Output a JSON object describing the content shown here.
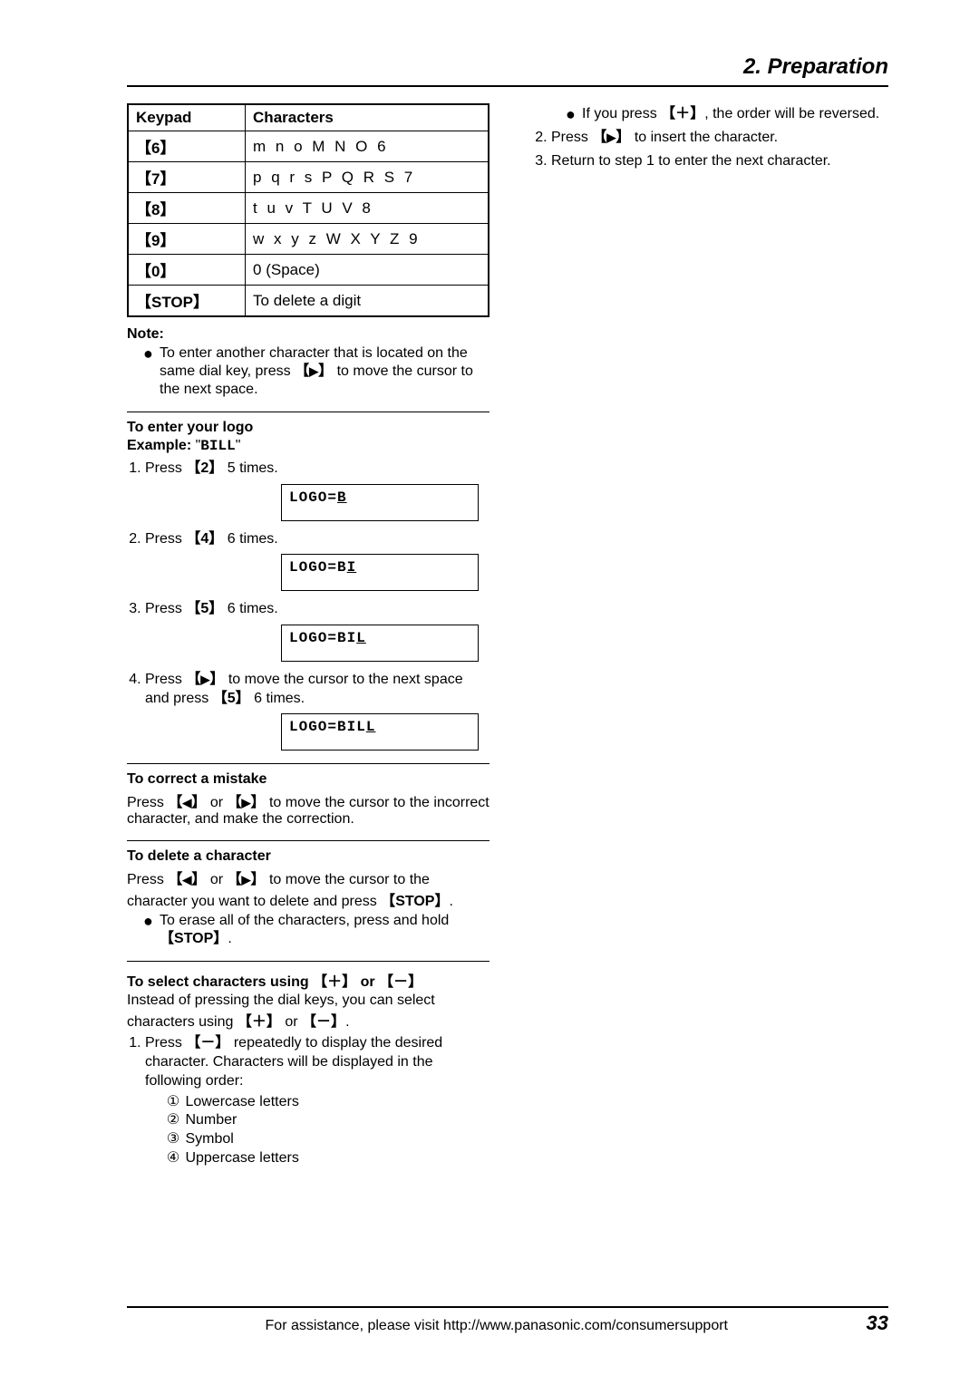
{
  "header": {
    "section_title": "2. Preparation"
  },
  "keypad_table": {
    "col_keypad": "Keypad",
    "col_chars": "Characters",
    "rows": [
      {
        "key": "【6】",
        "chars": "m  n  o  M  N  O  6"
      },
      {
        "key": "【7】",
        "chars": "p  q  r  s  P  Q  R  S  7"
      },
      {
        "key": "【8】",
        "chars": "t   u  v  T  U  V  8"
      },
      {
        "key": "【9】",
        "chars": "w  x  y  z  W  X  Y  Z  9"
      },
      {
        "key": "【0】",
        "chars": "0   (Space)"
      },
      {
        "key": "【STOP】",
        "chars": "To delete a digit"
      }
    ]
  },
  "note": {
    "label": "Note:",
    "text_pre": "To enter another character that is located on the same dial key, press ",
    "key": "▶",
    "text_post": " to move the cursor to the next space."
  },
  "logo_section": {
    "heading": "To enter your logo",
    "example_label": "Example: ",
    "example_quote_open": "\"",
    "example_value": "BILL",
    "example_quote_close": "\"",
    "steps": {
      "s1_pre": "Press ",
      "s1_key": "2",
      "s1_post": " 5 times.",
      "s1_lcd_prefix": "LOGO=",
      "s1_lcd_cursor": "B",
      "s2_pre": "Press ",
      "s2_key": "4",
      "s2_post": " 6 times.",
      "s2_lcd_prefix": "LOGO=B",
      "s2_lcd_cursor": "I",
      "s3_pre": "Press ",
      "s3_key": "5",
      "s3_post": " 6 times.",
      "s3_lcd_prefix": "LOGO=BI",
      "s3_lcd_cursor": "L",
      "s4_pre": "Press ",
      "s4_key1": "▶",
      "s4_mid": " to move the cursor to the next space and press ",
      "s4_key2": "5",
      "s4_post": " 6 times.",
      "s4_lcd_prefix": "LOGO=BIL",
      "s4_lcd_cursor": "L"
    }
  },
  "correct": {
    "heading": "To correct a mistake",
    "text_pre": "Press ",
    "key_left": "◀",
    "or": " or ",
    "key_right": "▶",
    "text_post": " to move the cursor to the incorrect character, and make the correction."
  },
  "delete": {
    "heading": "To delete a character",
    "text_pre": "Press ",
    "key_left": "◀",
    "or": " or ",
    "key_right": "▶",
    "text_mid": " to move the cursor to the character you want to delete and press ",
    "key_stop": "STOP",
    "text_post": ".",
    "bullet_pre": "To erase all of the characters, press and hold ",
    "bullet_key": "STOP",
    "bullet_post": "."
  },
  "select": {
    "heading_pre": "To select characters using ",
    "heading_plus": "＋",
    "heading_or": " or ",
    "heading_minus": "－",
    "intro_pre": "Instead of pressing the dial keys, you can select characters using ",
    "intro_plus": "＋",
    "intro_or": " or ",
    "intro_minus": "－",
    "intro_post": ".",
    "steps": {
      "s1_pre": "Press ",
      "s1_key": "－",
      "s1_post": " repeatedly to display the desired character. Characters will be displayed in the following order:",
      "sub1": "Lowercase letters",
      "sub2": "Number",
      "sub3": "Symbol",
      "sub4": "Uppercase letters"
    }
  },
  "right_col": {
    "bul_pre": "If you press ",
    "bul_key": "＋",
    "bul_post": ", the order will be reversed.",
    "s2_pre": "Press ",
    "s2_key": "▶",
    "s2_post": " to insert the character.",
    "s3": "Return to step 1 to enter the next character."
  },
  "footer": {
    "text": "For assistance, please visit http://www.panasonic.com/consumersupport",
    "page": "33"
  }
}
